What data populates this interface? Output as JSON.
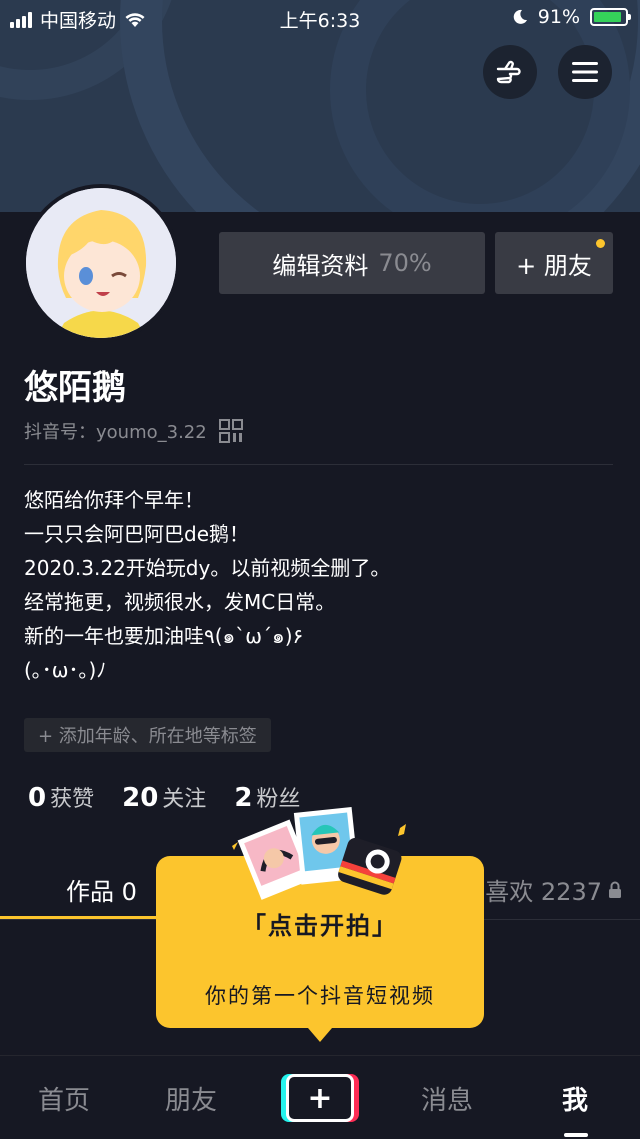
{
  "status_bar": {
    "carrier": "中国移动",
    "time": "上午6:33",
    "battery": "91%",
    "battery_level": 0.91
  },
  "profile": {
    "name": "悠陌鹅",
    "douyin_id_label": "抖音号：",
    "douyin_id": "youmo_3.22",
    "edit_button": "编辑资料",
    "edit_progress": "70%",
    "add_friend_button": "+ 朋友",
    "bio_lines": [
      "悠陌给你拜个早年！",
      "一只只会阿巴阿巴de鹅！",
      "2020.3.22开始玩dy。以前视频全删了。",
      "经常拖更，视频很水，发MC日常。",
      "新的一年也要加油哇٩(๑`ω´๑)۶",
      "(｡･ω･｡)ﾉ"
    ],
    "tag_button": "+ 添加年龄、所在地等标签"
  },
  "stats": [
    {
      "num": "0",
      "label": "获赞"
    },
    {
      "num": "20",
      "label": "关注"
    },
    {
      "num": "2",
      "label": "粉丝"
    }
  ],
  "tabs": {
    "works": "作品 0",
    "likes": "喜欢 2237"
  },
  "tooltip": {
    "title": "「点击开拍」",
    "subtitle": "你的第一个抖音短视频"
  },
  "bottom_nav": {
    "home": "首页",
    "friends": "朋友",
    "messages": "消息",
    "me": "我"
  },
  "colors": {
    "accent": "#fcc52d",
    "background": "#161823",
    "battery": "#35d25a"
  }
}
